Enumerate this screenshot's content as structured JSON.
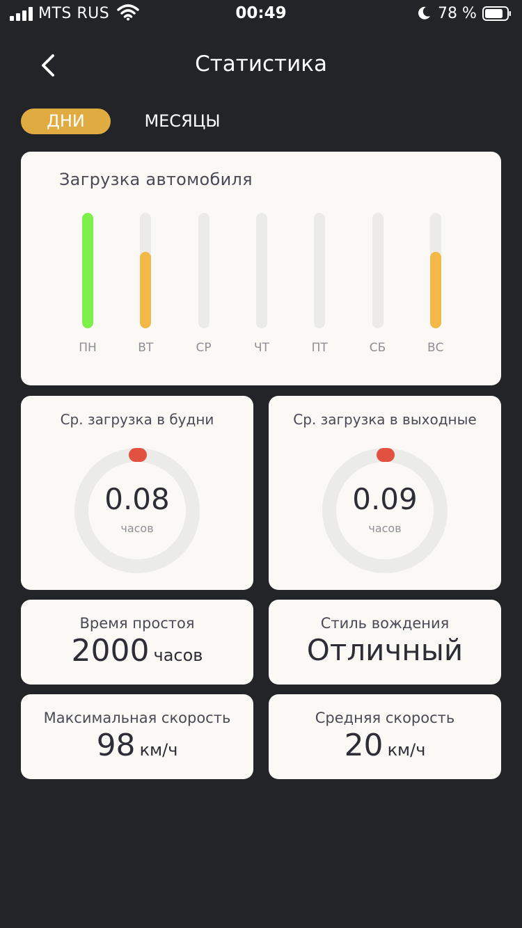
{
  "status_bar": {
    "carrier": "MTS RUS",
    "time": "00:49",
    "battery": "78 %"
  },
  "header": {
    "title": "Статистика"
  },
  "tabs": [
    {
      "label": "ДНИ",
      "active": true
    },
    {
      "label": "МЕСЯЦЫ",
      "active": false
    }
  ],
  "colors": {
    "background": "#222427",
    "accent": "#e0ab41",
    "bar_green": "#7ef04a",
    "bar_yellow": "#f2b948",
    "marker_red": "#e2503f",
    "card": "#faf9f6"
  },
  "load_chart": {
    "title": "Загрузка автомобиля",
    "days": [
      {
        "label": "ПН",
        "fill": 1.0,
        "color": "#7ef04a"
      },
      {
        "label": "ВТ",
        "fill": 0.66,
        "color": "#f2b948"
      },
      {
        "label": "СР",
        "fill": 0,
        "color": "#f2b948"
      },
      {
        "label": "ЧТ",
        "fill": 0,
        "color": "#f2b948"
      },
      {
        "label": "ПТ",
        "fill": 0,
        "color": "#f2b948"
      },
      {
        "label": "СБ",
        "fill": 0,
        "color": "#f2b948"
      },
      {
        "label": "ВС",
        "fill": 0.66,
        "color": "#f2b948"
      }
    ]
  },
  "gauges": [
    {
      "title": "Ср. загрузка в будни",
      "value": "0.08",
      "unit": "часов"
    },
    {
      "title": "Ср. загрузка в выходные",
      "value": "0.09",
      "unit": "часов"
    }
  ],
  "stats": {
    "idle": {
      "title": "Время простоя",
      "value": "2000",
      "unit": "часов"
    },
    "style": {
      "title": "Стиль вождения",
      "value": "Отличный"
    },
    "max_speed": {
      "title": "Максимальная скорость",
      "value": "98",
      "unit": "км/ч"
    },
    "avg_speed": {
      "title": "Средняя скорость",
      "value": "20",
      "unit": "км/ч"
    }
  }
}
